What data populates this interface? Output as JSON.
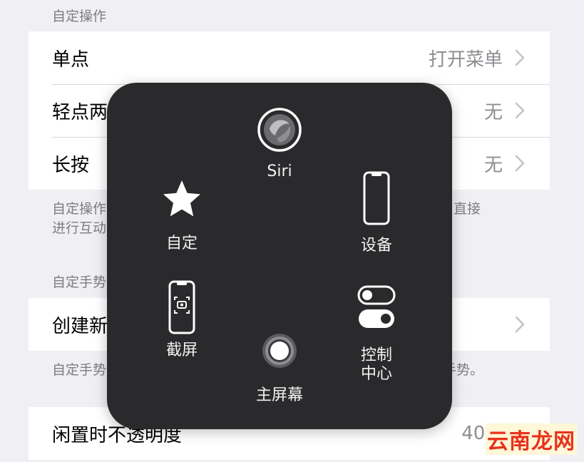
{
  "sections": {
    "custom_actions": {
      "header": "自定操作",
      "rows": [
        {
          "label": "单点",
          "value": "打开菜单"
        },
        {
          "label": "轻点两",
          "value": "无"
        },
        {
          "label": "长按",
          "value": "无"
        }
      ],
      "footnote_line1_left": "自定操作",
      "footnote_line1_right": "直接",
      "footnote_line2_left": "进行互动"
    },
    "custom_gestures": {
      "header": "自定手势",
      "row_label": "创建新",
      "footnote_left": "自定手势",
      "footnote_right": "手势。"
    },
    "opacity": {
      "label": "闲置时不透明度",
      "value": "40%"
    }
  },
  "menu": {
    "siri": "Siri",
    "custom": "自定",
    "device": "设备",
    "screenshot": "截屏",
    "control_center": "控制\n中心",
    "home": "主屏幕"
  },
  "watermark": "云南龙网",
  "colors": {
    "background": "#efeff4",
    "overlay": "#2a2a2c",
    "secondary_text": "#8e8e93",
    "watermark": "#e8321c"
  }
}
